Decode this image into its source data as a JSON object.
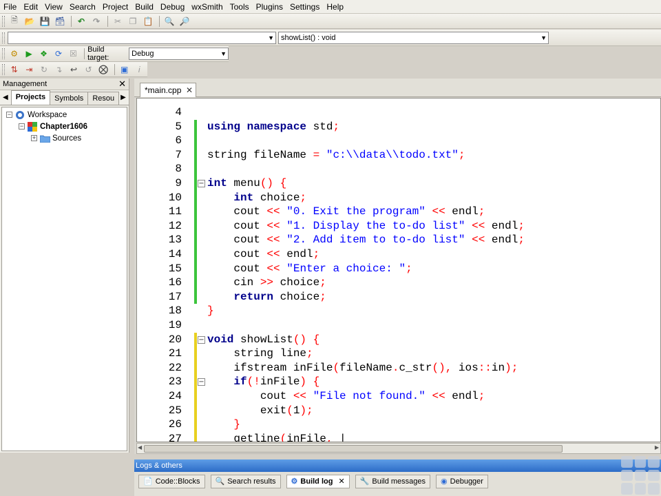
{
  "menu": [
    "File",
    "Edit",
    "View",
    "Search",
    "Project",
    "Build",
    "Debug",
    "wxSmith",
    "Tools",
    "Plugins",
    "Settings",
    "Help"
  ],
  "toolbar2": {
    "scope_value": "",
    "function_value": "showList() : void"
  },
  "toolbar3": {
    "build_target_label": "Build target:",
    "build_target_value": "Debug"
  },
  "management": {
    "title": "Management",
    "tabs": [
      "Projects",
      "Symbols",
      "Resou"
    ],
    "tree": {
      "workspace": "Workspace",
      "project": "Chapter1606",
      "folder": "Sources"
    }
  },
  "editor": {
    "tab_label": "*main.cpp",
    "lines": [
      {
        "n": "4",
        "html": ""
      },
      {
        "n": "5",
        "html": "<span class='kw'>using namespace</span> std<span class='op'>;</span>"
      },
      {
        "n": "6",
        "html": ""
      },
      {
        "n": "7",
        "html": "string fileName <span class='op'>=</span> <span class='str'>\"c:\\\\data\\\\todo.txt\"</span><span class='op'>;</span>"
      },
      {
        "n": "8",
        "html": ""
      },
      {
        "n": "9",
        "html": "<span class='kw'>int</span> menu<span class='op'>()</span> <span class='op'>{</span>"
      },
      {
        "n": "10",
        "html": "    <span class='kw'>int</span> choice<span class='op'>;</span>"
      },
      {
        "n": "11",
        "html": "    cout <span class='op'>&lt;&lt;</span> <span class='str'>\"0. Exit the program\"</span> <span class='op'>&lt;&lt;</span> endl<span class='op'>;</span>"
      },
      {
        "n": "12",
        "html": "    cout <span class='op'>&lt;&lt;</span> <span class='str'>\"1. Display the to-do list\"</span> <span class='op'>&lt;&lt;</span> endl<span class='op'>;</span>"
      },
      {
        "n": "13",
        "html": "    cout <span class='op'>&lt;&lt;</span> <span class='str'>\"2. Add item to to-do list\"</span> <span class='op'>&lt;&lt;</span> endl<span class='op'>;</span>"
      },
      {
        "n": "14",
        "html": "    cout <span class='op'>&lt;&lt;</span> endl<span class='op'>;</span>"
      },
      {
        "n": "15",
        "html": "    cout <span class='op'>&lt;&lt;</span> <span class='str'>\"Enter a choice: \"</span><span class='op'>;</span>"
      },
      {
        "n": "16",
        "html": "    cin <span class='op'>&gt;&gt;</span> choice<span class='op'>;</span>"
      },
      {
        "n": "17",
        "html": "    <span class='kw'>return</span> choice<span class='op'>;</span>"
      },
      {
        "n": "18",
        "html": "<span class='op'>}</span>"
      },
      {
        "n": "19",
        "html": ""
      },
      {
        "n": "20",
        "html": "<span class='kw'>void</span> showList<span class='op'>()</span> <span class='op'>{</span>"
      },
      {
        "n": "21",
        "html": "    string line<span class='op'>;</span>"
      },
      {
        "n": "22",
        "html": "    ifstream inFile<span class='op'>(</span>fileName<span class='op'>.</span>c_str<span class='op'>(),</span> ios<span class='op'>::</span>in<span class='op'>);</span>"
      },
      {
        "n": "23",
        "html": "    <span class='kw'>if</span><span class='op'>(!</span>inFile<span class='op'>)</span> <span class='op'>{</span>"
      },
      {
        "n": "24",
        "html": "        cout <span class='op'>&lt;&lt;</span> <span class='str'>\"File not found.\"</span> <span class='op'>&lt;&lt;</span> endl<span class='op'>;</span>"
      },
      {
        "n": "25",
        "html": "        exit<span class='op'>(</span>1<span class='op'>);</span>"
      },
      {
        "n": "26",
        "html": "    <span class='op'>}</span>"
      },
      {
        "n": "27",
        "html": "    getline<span class='op'>(</span>inFile<span class='op'>,</span> |"
      }
    ]
  },
  "logs": {
    "title": "Logs & others",
    "tabs": [
      {
        "label": "Code::Blocks",
        "icon": "document-icon"
      },
      {
        "label": "Search results",
        "icon": "search-icon"
      },
      {
        "label": "Build log",
        "icon": "gear-icon"
      },
      {
        "label": "Build messages",
        "icon": "wrench-icon"
      },
      {
        "label": "Debugger",
        "icon": "debug-icon"
      }
    ],
    "active": "Build log"
  }
}
